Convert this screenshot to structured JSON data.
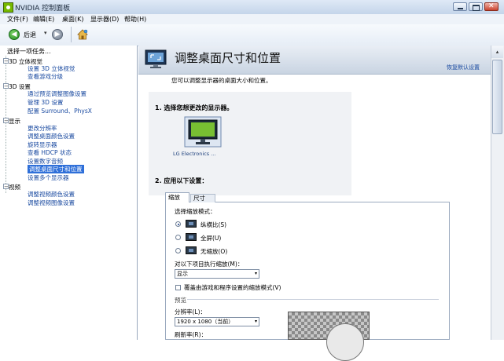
{
  "window": {
    "title": "NVIDIA 控制面板"
  },
  "menu": {
    "items": [
      "文件(F)",
      "编辑(E)",
      "桌面(K)",
      "显示器(D)",
      "帮助(H)"
    ]
  },
  "toolbar": {
    "back_label": "后退",
    "back_dropdown_arrow": "▾"
  },
  "sidebar": {
    "heading": "选择一项任务...",
    "categories": [
      {
        "label": "3D 立体视觉",
        "expander": "−",
        "items": [
          "设置 3D 立体视觉",
          "查看游戏分级"
        ]
      },
      {
        "label": "3D 设置",
        "expander": "−",
        "items": [
          "通过预览调整图像设置",
          "管理 3D 设置",
          "配置 Surround、PhysX"
        ]
      },
      {
        "label": "显示",
        "expander": "−",
        "items": [
          "更改分辨率",
          "调整桌面颜色设置",
          "旋转显示器",
          "查看 HDCP 状态",
          "设置数字音频",
          "调整桌面尺寸和位置",
          "设置多个显示器"
        ]
      },
      {
        "label": "视频",
        "expander": "−",
        "items": [
          "调整视频颜色设置",
          "调整视频图像设置"
        ]
      }
    ],
    "selected_item": "调整桌面尺寸和位置"
  },
  "main": {
    "title": "调整桌面尺寸和位置",
    "restore_defaults": "恢复默认设置",
    "description": "您可以调整显示器的桌面大小和位置。",
    "step1": "1. 选择您想更改的显示器。",
    "monitor_label": "LG Electronics ...",
    "step2": "2. 应用以下设置：",
    "tabs": [
      {
        "label": "缩放",
        "active": true
      },
      {
        "label": "尺寸",
        "active": false
      }
    ],
    "scaling_mode_label": "选择缩放模式：",
    "scaling_modes": [
      {
        "label": "纵横比(S)",
        "checked": true
      },
      {
        "label": "全屏(U)",
        "checked": false
      },
      {
        "label": "无缩放(O)",
        "checked": false
      }
    ],
    "perform_on_label": "对以下项目执行缩放(M)：",
    "perform_on_value": "显示",
    "override_label": "覆盖由游戏和程序设置的缩放模式(V)",
    "preview_heading": "预览",
    "resolution_label": "分辨率(L)：",
    "resolution_value": "1920 x 1080（当前）",
    "refresh_label": "刷新率(R)：",
    "dropdown_arrow": "▾"
  },
  "scrollbar": {
    "up_arrow": "▴"
  }
}
